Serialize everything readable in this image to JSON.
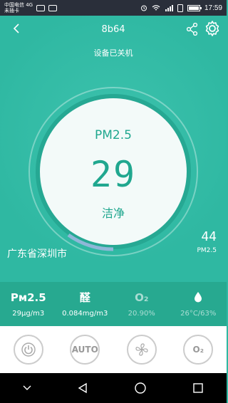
{
  "status_bar": {
    "carrier_line1": "中国电信 4G",
    "carrier_line2": "未插卡",
    "time": "17:59"
  },
  "header": {
    "title": "8b64",
    "device_status": "设备已关机"
  },
  "gauge": {
    "pm_label": "PM2.5",
    "pm_value": "29",
    "quality_text": "洁净"
  },
  "location": "广东省深圳市",
  "outdoor": {
    "value": "44",
    "label": "PM2.5"
  },
  "metrics": [
    {
      "icon": "Pᴍ2.5",
      "value": "29μg/m3",
      "active": true
    },
    {
      "icon": "醛",
      "value": "0.084mg/m3",
      "active": true
    },
    {
      "icon": "O₂",
      "value": "20.90%",
      "active": false
    },
    {
      "icon": "water-drop-icon",
      "value": "26°C/63%",
      "active": false
    }
  ],
  "controls": {
    "auto_label": "AUTO",
    "oxygen_label": "O₂"
  },
  "colors": {
    "primary": "#2fb8a2",
    "panel": "#27a990",
    "accent": "#20a78f"
  }
}
